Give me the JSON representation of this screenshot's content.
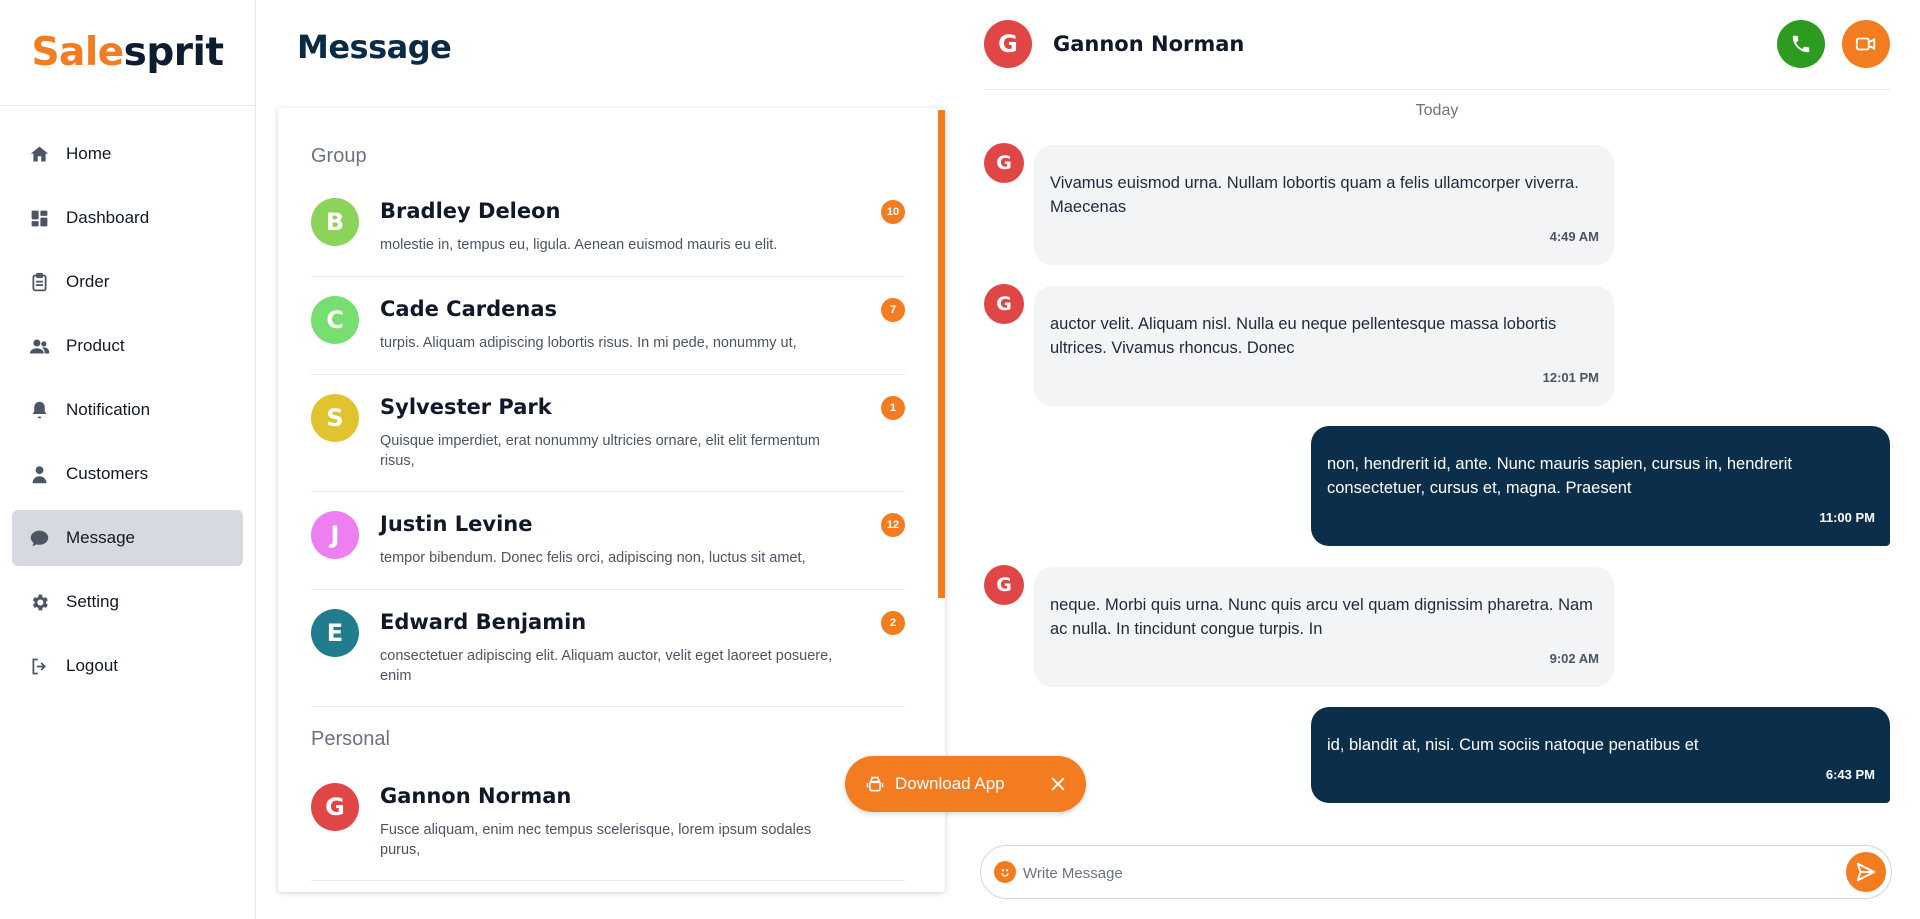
{
  "brand": {
    "part1": "Sale",
    "part2": "sprit",
    "color_primary": "#f47c20",
    "color_dark": "#0b1d2e"
  },
  "sidebar": {
    "items": [
      {
        "label": "Home",
        "icon": "home-icon"
      },
      {
        "label": "Dashboard",
        "icon": "dashboard-icon"
      },
      {
        "label": "Order",
        "icon": "clipboard-icon"
      },
      {
        "label": "Product",
        "icon": "users-icon"
      },
      {
        "label": "Notification",
        "icon": "bell-icon"
      },
      {
        "label": "Customers",
        "icon": "user-icon"
      },
      {
        "label": "Message",
        "icon": "chat-bubble-icon",
        "active": true
      },
      {
        "label": "Setting",
        "icon": "gear-icon"
      },
      {
        "label": "Logout",
        "icon": "logout-icon"
      }
    ]
  },
  "page": {
    "title": "Message"
  },
  "conversations": {
    "group_label": "Group",
    "personal_label": "Personal",
    "group": [
      {
        "initial": "B",
        "name": "Bradley Deleon",
        "snippet": "molestie in, tempus eu, ligula. Aenean euismod mauris eu elit.",
        "unread": "10",
        "color": "#8bd35a"
      },
      {
        "initial": "C",
        "name": "Cade Cardenas",
        "snippet": "turpis. Aliquam adipiscing lobortis risus. In mi pede, nonummy ut,",
        "unread": "7",
        "color": "#76df6f"
      },
      {
        "initial": "S",
        "name": "Sylvester Park",
        "snippet": "Quisque imperdiet, erat nonummy ultricies ornare, elit elit fermentum risus,",
        "unread": "1",
        "color": "#e1c22f"
      },
      {
        "initial": "J",
        "name": "Justin Levine",
        "snippet": "tempor bibendum. Donec felis orci, adipiscing non, luctus sit amet,",
        "unread": "12",
        "color": "#ee7ff0"
      },
      {
        "initial": "E",
        "name": "Edward Benjamin",
        "snippet": "consectetuer adipiscing elit. Aliquam auctor, velit eget laoreet posuere, enim",
        "unread": "2",
        "color": "#217c8e"
      }
    ],
    "personal": [
      {
        "initial": "G",
        "name": "Gannon Norman",
        "snippet": "Fusce aliquam, enim nec tempus scelerisque, lorem ipsum sodales purus,",
        "color": "#e04646"
      }
    ]
  },
  "download": {
    "label": "Download App"
  },
  "chat": {
    "contact_initial": "G",
    "contact_name": "Gannon Norman",
    "day": "Today",
    "messages": [
      {
        "dir": "in",
        "text": "Vivamus euismod urna. Nullam lobortis quam a felis ullamcorper viverra. Maecenas",
        "time": "4:49 AM"
      },
      {
        "dir": "in",
        "text": "auctor velit. Aliquam nisl. Nulla eu neque pellentesque massa lobortis ultrices. Vivamus rhoncus. Donec",
        "time": "12:01 PM"
      },
      {
        "dir": "out",
        "text": "non, hendrerit id, ante. Nunc mauris sapien, cursus in, hendrerit consectetuer, cursus et, magna. Praesent",
        "time": "11:00 PM"
      },
      {
        "dir": "in",
        "text": "neque. Morbi quis urna. Nunc quis arcu vel quam dignissim pharetra. Nam ac nulla. In tincidunt congue turpis. In",
        "time": "9:02 AM"
      },
      {
        "dir": "out",
        "text": "id, blandit at, nisi. Cum sociis natoque penatibus et",
        "time": "6:43 PM"
      }
    ],
    "composer_placeholder": "Write Message"
  }
}
